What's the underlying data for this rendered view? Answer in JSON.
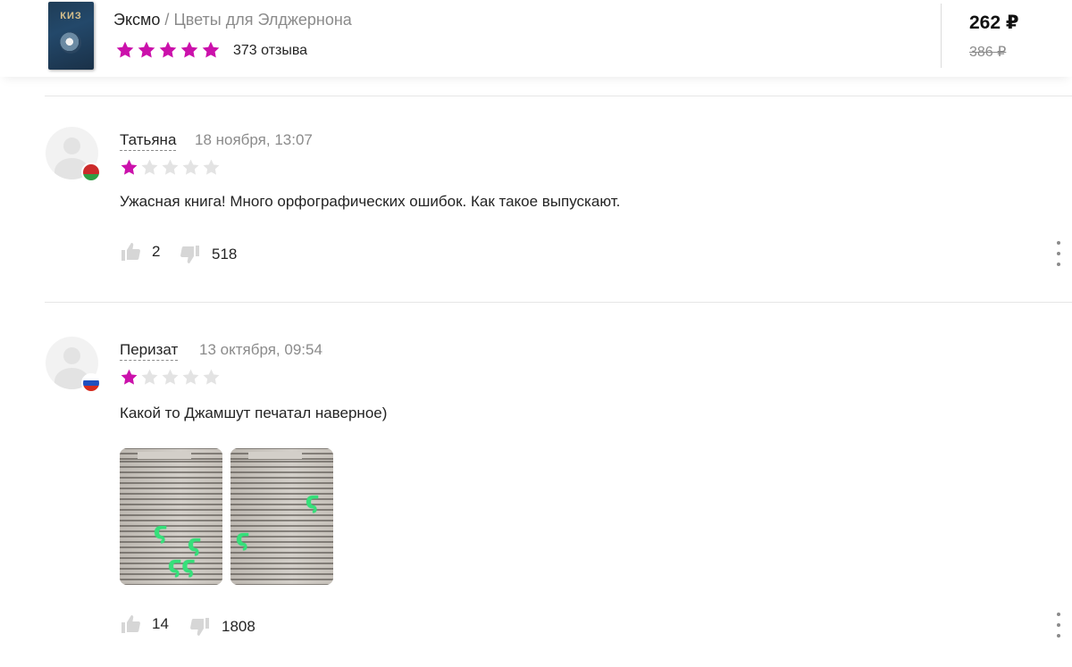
{
  "product": {
    "cover_title": "КИЗ",
    "brand": "Эксмо",
    "separator": "/",
    "name": "Цветы для Элджернона",
    "rating_stars": 5,
    "reviews_count": "373 отзыва",
    "price_current": "262 ₽",
    "price_old": "386 ₽"
  },
  "colors": {
    "accent_star": "#CB11AB",
    "empty_star": "#E3E3E3",
    "annotation_mark": "#35E07A"
  },
  "reviews": [
    {
      "author": "Татьяна",
      "date": "18 ноября, 13:07",
      "flag_icon": "belarus-flag-icon",
      "rating": 1,
      "text": "Ужасная книга! Много орфографических ошибок. Как такое выпускают.",
      "likes": "2",
      "dislikes": "518"
    },
    {
      "author": "Перизат",
      "date": "13 октября, 09:54",
      "flag_icon": "russia-flag-icon",
      "rating": 1,
      "text": "Какой то Джамшут печатал наверное)",
      "photos": [
        "review-photo-1",
        "review-photo-2"
      ],
      "likes": "14",
      "dislikes": "1808"
    }
  ]
}
